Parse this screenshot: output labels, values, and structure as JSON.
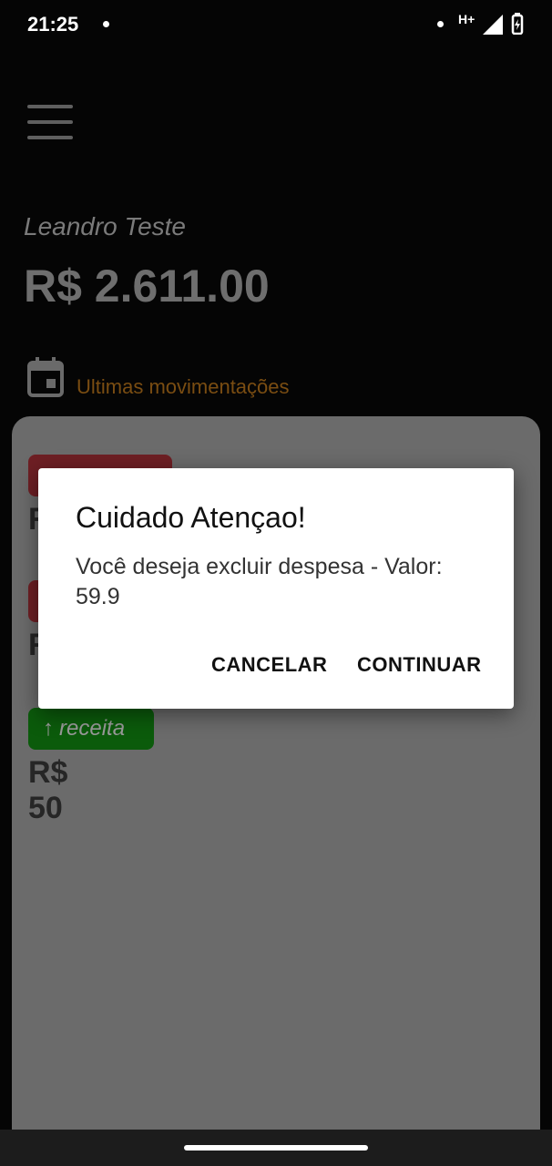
{
  "status": {
    "time": "21:25",
    "network": "H+"
  },
  "header": {
    "user_name": "Leandro Teste",
    "balance": "R$ 2.611.00"
  },
  "section": {
    "title": "Ultimas movimentações"
  },
  "transactions": [
    {
      "type_label": "",
      "amount": "R",
      "color": "#6e1f24",
      "direction": "down"
    },
    {
      "type_label": "",
      "amount": "R",
      "color": "#6e1f24",
      "direction": "down"
    },
    {
      "type_label": "receita",
      "amount": "R$ 50",
      "color": "#0b5b0b",
      "direction": "up"
    }
  ],
  "dialog": {
    "title": "Cuidado Atençao!",
    "message": "Você deseja excluir despesa - Valor: 59.9",
    "cancel_label": "CANCELAR",
    "continue_label": "CONTINUAR"
  },
  "colors": {
    "accent": "#7a4d12",
    "expense": "#6e1f24",
    "income": "#0b5b0b",
    "dialog_bg": "#ffffff"
  }
}
